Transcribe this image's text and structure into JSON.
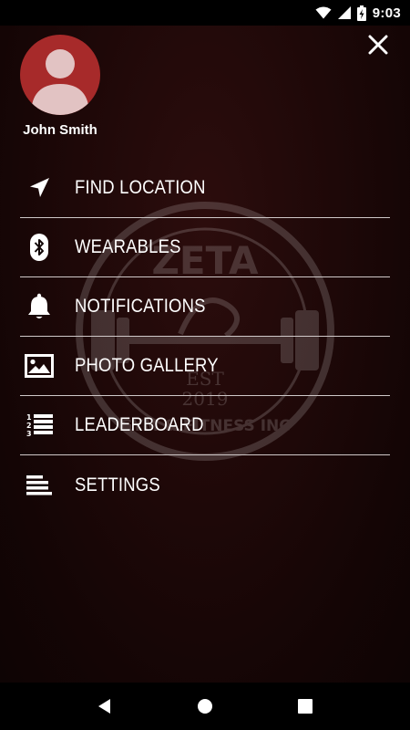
{
  "status_bar": {
    "time": "9:03"
  },
  "user": {
    "name": "John Smith"
  },
  "menu": {
    "items": [
      {
        "label": "FIND LOCATION",
        "icon": "navigation-arrow-icon"
      },
      {
        "label": "WEARABLES",
        "icon": "bluetooth-icon"
      },
      {
        "label": "NOTIFICATIONS",
        "icon": "bell-icon"
      },
      {
        "label": "PHOTO GALLERY",
        "icon": "image-icon"
      },
      {
        "label": "LEADERBOARD",
        "icon": "ranked-list-icon"
      },
      {
        "label": "SETTINGS",
        "icon": "settings-lines-icon"
      }
    ]
  },
  "watermark": {
    "brand": "ZETA",
    "est": "EST",
    "year": "2019",
    "tagline": "GYM & FITNESS INC"
  },
  "colors": {
    "accent": "#a72a2a",
    "background": "#1e0808",
    "divider": "#cfc8c8"
  }
}
